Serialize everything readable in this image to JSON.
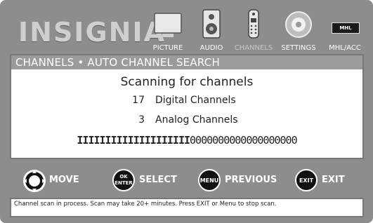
{
  "header": {
    "logo": "INSIGNIA",
    "menu": [
      {
        "label": "PICTURE",
        "icon": "tv-icon"
      },
      {
        "label": "AUDIO",
        "icon": "speaker-icon"
      },
      {
        "label": "CHANNELS",
        "icon": "remote-icon"
      },
      {
        "label": "SETTINGS",
        "icon": "gear-icon"
      },
      {
        "label": "MHL/ACC",
        "icon": "mhl-icon",
        "badge": "MHL"
      }
    ]
  },
  "panel": {
    "title": "CHANNELS • AUTO CHANNEL SEARCH",
    "scan_title": "Scanning for channels",
    "digital_count": "17",
    "digital_label": "Digital Channels",
    "analog_count": "3",
    "analog_label": "Analog Channels",
    "progress_filled": "IIIIIIIIIIIIIIIIIIII",
    "progress_empty": "0000000000000000000",
    "progress_fraction": 0.51
  },
  "buttons": {
    "move": {
      "label": "MOVE"
    },
    "select": {
      "label": "SELECT",
      "key": "OK\nENTER"
    },
    "previous": {
      "label": "PREVIOUS",
      "key": "MENU"
    },
    "exit": {
      "label": "EXIT",
      "key": "EXIT"
    }
  },
  "status": {
    "text": "Channel scan in process. Scan may take 20+ minutes. Press EXIT or Menu to stop scan."
  },
  "colors": {
    "background": "#8d8d8d",
    "panel": "#ffffff",
    "title_bar": "#9b9b9b"
  }
}
